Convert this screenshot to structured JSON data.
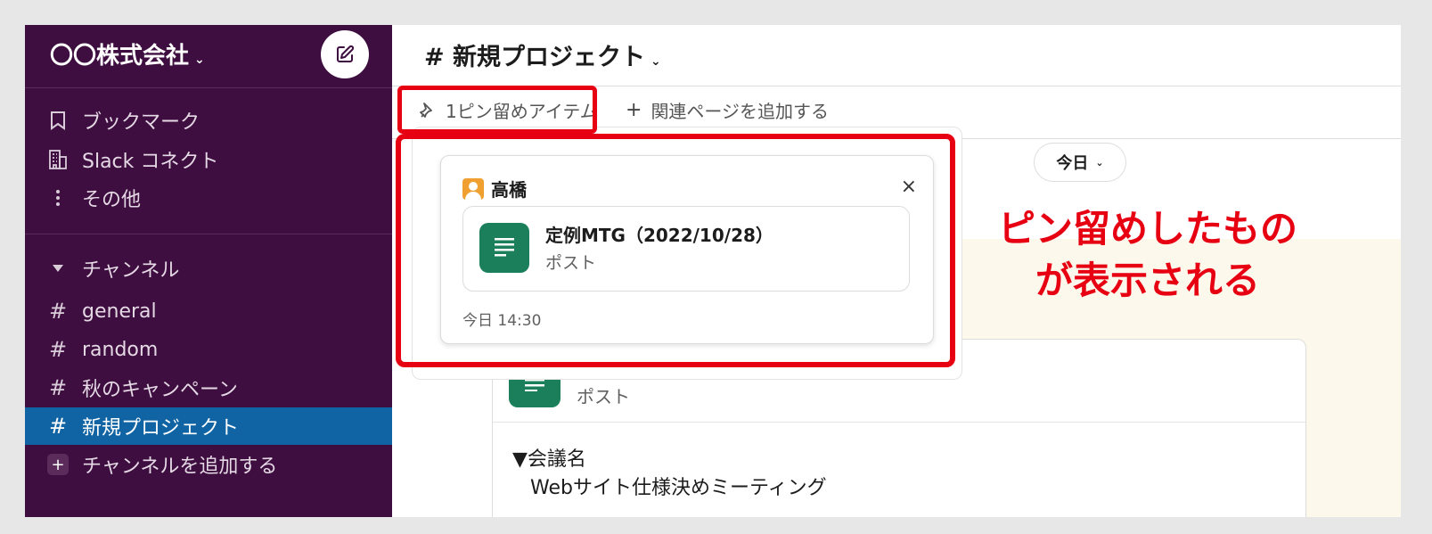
{
  "sidebar": {
    "workspace_name": "〇〇株式会社",
    "top_items": [
      {
        "label": "ブックマーク",
        "icon": "bookmark-icon"
      },
      {
        "label": "Slack コネクト",
        "icon": "building-icon"
      },
      {
        "label": "その他",
        "icon": "more-vertical-icon"
      }
    ],
    "channels_header": "チャンネル",
    "channels": [
      {
        "label": "general",
        "active": false
      },
      {
        "label": "random",
        "active": false
      },
      {
        "label": "秋のキャンペーン",
        "active": false
      },
      {
        "label": "新規プロジェクト",
        "active": true
      }
    ],
    "add_channel_label": "チャンネルを追加する",
    "hash_symbol": "#",
    "colors": {
      "bg": "#3f0e40",
      "active": "#1164a3"
    }
  },
  "channel": {
    "title": "新規プロジェクト",
    "hash_symbol": "#",
    "pin_tab_label": "1ピン留めアイテム",
    "add_page_label": "関連ページを追加する",
    "date_pill": "今日"
  },
  "pinned_popup": {
    "author": "高橋",
    "close_symbol": "×",
    "attachment_title": "定例MTG（2022/10/28）",
    "attachment_type": "ポスト",
    "timestamp": "今日 14:30"
  },
  "background_post": {
    "type_label": "ポスト",
    "meeting_heading": "▼会議名",
    "meeting_name": "Webサイト仕様決めミーティング"
  },
  "annotation": {
    "line1": "ピン留めしたもの",
    "line2": "が表示される",
    "color": "#e60012"
  }
}
